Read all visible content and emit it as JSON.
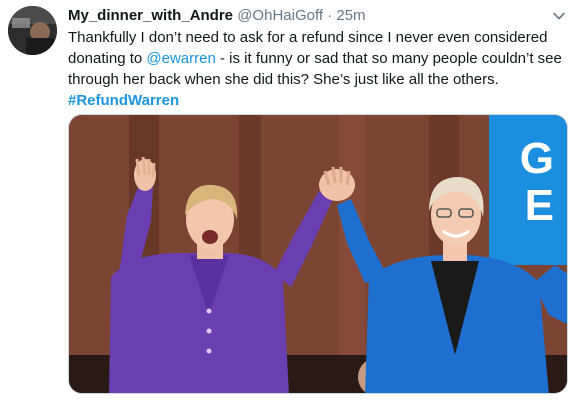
{
  "tweet": {
    "display_name": "My_dinner_with_Andre",
    "handle": "@OhHaiGoff",
    "separator": "·",
    "time": "25m",
    "text_part1": "Thankfully I don’t need to ask for a refund since I never even considered donating to ",
    "mention": "@ewarren",
    "text_part2": " - is it funny or sad that so many people couldn’t see through her back when she did this? She’s just like all the others.",
    "hashtag": "#RefundWarren"
  },
  "media": {
    "sign_text": "G\nE"
  },
  "colors": {
    "link": "#1b95e0",
    "secondary_text": "#657786",
    "purple_outfit": "#6a3fb0",
    "blue_outfit": "#1f6fd0",
    "sign_blue": "#1c8ee0"
  },
  "icons": [
    "avatar",
    "chevron-down-icon"
  ]
}
